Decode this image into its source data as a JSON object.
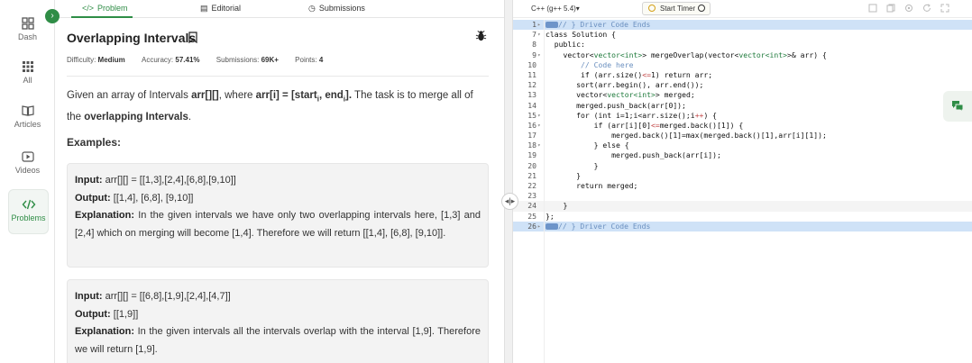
{
  "nav": {
    "items": [
      {
        "label": "Dash",
        "icon": "dashboard-icon"
      },
      {
        "label": "All",
        "icon": "grid-icon"
      },
      {
        "label": "Articles",
        "icon": "book-icon"
      },
      {
        "label": "Videos",
        "icon": "play-icon"
      },
      {
        "label": "Problems",
        "icon": "code-icon"
      }
    ],
    "collapse_glyph": "›"
  },
  "tabs": [
    {
      "label": "Problem",
      "glyph": "</>"
    },
    {
      "label": "Editorial",
      "glyph": "▤"
    },
    {
      "label": "Submissions",
      "glyph": "◷"
    }
  ],
  "problem": {
    "title": "Overlapping Intervals",
    "meta": {
      "difficulty_label": "Difficulty:",
      "difficulty_value": "Medium",
      "accuracy_label": "Accuracy:",
      "accuracy_value": "57.41%",
      "submissions_label": "Submissions:",
      "submissions_value": "69K+",
      "points_label": "Points:",
      "points_value": "4"
    },
    "desc": {
      "p1": "Given an array of Intervals ",
      "arr": "arr[][]",
      "p2": ", where ",
      "def_a": "arr[i] = [start",
      "sub_i1": "i",
      "def_b": ", end",
      "sub_i2": "i",
      "def_c": "].",
      "p3": " The task is to merge all of the ",
      "bold_end": "overlapping Intervals",
      "p4": "."
    },
    "examples_heading": "Examples:",
    "examples": [
      {
        "input_label": "Input:",
        "input_value": " arr[][] = [[1,3],[2,4],[6,8],[9,10]]",
        "output_label": "Output:",
        "output_value": " [[1,4], [6,8], [9,10]]",
        "explanation_label": "Explanation:",
        "explanation_value": " In the given intervals we have only two overlapping intervals here, [1,3] and [2,4] which on merging will become [1,4]. Therefore we will return [[1,4], [6,8], [9,10]]."
      },
      {
        "input_label": "Input:",
        "input_value": " arr[][] = [[6,8],[1,9],[2,4],[4,7]]",
        "output_label": "Output:",
        "output_value": " [[1,9]]",
        "explanation_label": "Explanation:",
        "explanation_value": " In the given intervals all the intervals overlap with the interval [1,9]. Therefore we will return [1,9]."
      }
    ]
  },
  "editor": {
    "language": "C++ (g++ 5.4)▾",
    "timer_label": "Start Timer",
    "splitter_glyph": "◂|▸",
    "lines": [
      {
        "n": "1",
        "fold": "▸",
        "hl": true,
        "parts": [
          [
            "marker",
            ""
          ],
          [
            "cmt",
            "// } Driver Code Ends"
          ]
        ]
      },
      {
        "n": "7",
        "fold": "▾",
        "parts": [
          [
            "",
            "class Solution {"
          ]
        ]
      },
      {
        "n": "8",
        "fold": "",
        "parts": [
          [
            "",
            "  public:"
          ]
        ]
      },
      {
        "n": "9",
        "fold": "▾",
        "parts": [
          [
            "",
            "    vector<"
          ],
          [
            "type",
            "vector<int>"
          ],
          [
            "",
            "> mergeOverlap(vector<"
          ],
          [
            "type",
            "vector<int>"
          ],
          [
            "",
            ">& arr) {"
          ]
        ]
      },
      {
        "n": "10",
        "fold": "",
        "parts": [
          [
            "cmt",
            "        // Code here"
          ]
        ]
      },
      {
        "n": "11",
        "fold": "",
        "parts": [
          [
            "",
            "        if (arr.size()"
          ],
          [
            "op",
            "<="
          ],
          [
            "",
            "1) return arr;"
          ]
        ]
      },
      {
        "n": "12",
        "fold": "",
        "parts": [
          [
            "",
            "       sort(arr.begin(), arr.end());"
          ]
        ]
      },
      {
        "n": "13",
        "fold": "",
        "parts": [
          [
            "",
            "       vector<"
          ],
          [
            "type",
            "vector<int>"
          ],
          [
            "",
            "> merged;"
          ]
        ]
      },
      {
        "n": "14",
        "fold": "",
        "parts": [
          [
            "",
            "       merged.push_back(arr[0]);"
          ]
        ]
      },
      {
        "n": "15",
        "fold": "▾",
        "parts": [
          [
            "",
            "       for (int i=1;i<arr.size();i"
          ],
          [
            "op",
            "++"
          ],
          [
            "",
            ") {"
          ]
        ]
      },
      {
        "n": "16",
        "fold": "▾",
        "parts": [
          [
            "",
            "           if (arr[i][0]"
          ],
          [
            "op",
            "<="
          ],
          [
            "",
            "merged.back()[1]) {"
          ]
        ]
      },
      {
        "n": "17",
        "fold": "",
        "parts": [
          [
            "",
            "               merged.back()[1]=max(merged.back()[1],arr[i][1]);"
          ]
        ]
      },
      {
        "n": "18",
        "fold": "▾",
        "parts": [
          [
            "",
            "           } else {"
          ]
        ]
      },
      {
        "n": "19",
        "fold": "",
        "parts": [
          [
            "",
            "               merged.push_back(arr[i]);"
          ]
        ]
      },
      {
        "n": "20",
        "fold": "",
        "parts": [
          [
            "",
            "           }"
          ]
        ]
      },
      {
        "n": "21",
        "fold": "",
        "parts": [
          [
            "",
            "       }"
          ]
        ]
      },
      {
        "n": "22",
        "fold": "",
        "parts": [
          [
            "",
            "       return merged;"
          ]
        ]
      },
      {
        "n": "23",
        "fold": "",
        "parts": [
          [
            "",
            ""
          ]
        ]
      },
      {
        "n": "24",
        "fold": "",
        "cur": true,
        "parts": [
          [
            "",
            "    }"
          ]
        ]
      },
      {
        "n": "25",
        "fold": "",
        "parts": [
          [
            "",
            "};"
          ]
        ]
      },
      {
        "n": "26",
        "fold": "▸",
        "hl": true,
        "parts": [
          [
            "marker",
            ""
          ],
          [
            "cmt",
            "// } Driver Code Ends"
          ]
        ]
      }
    ]
  }
}
